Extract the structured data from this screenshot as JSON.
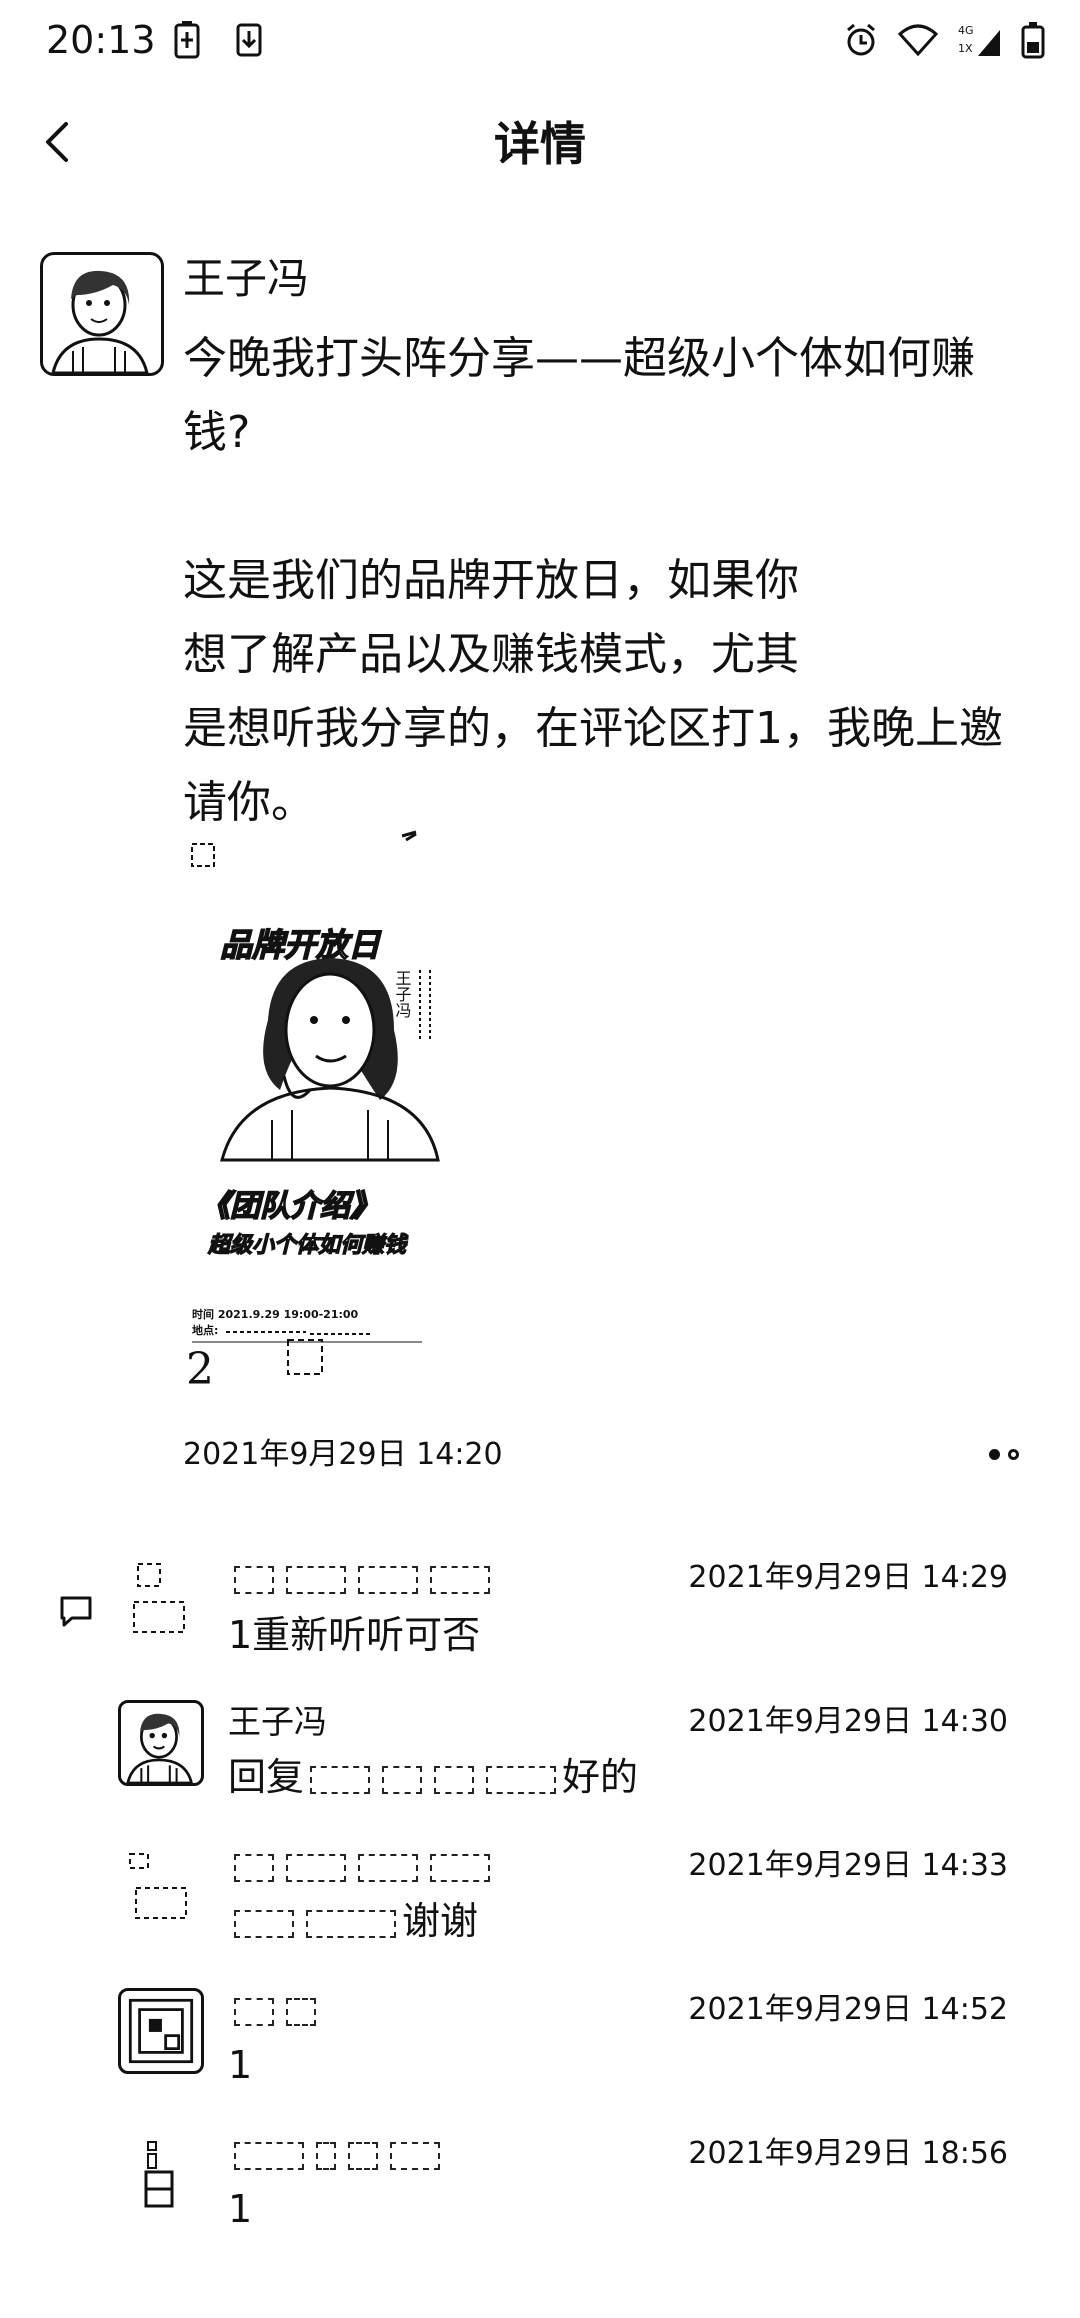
{
  "status_bar": {
    "time": "20:13",
    "left_icons": [
      "battery-saver-icon",
      "download-icon"
    ],
    "right_icons": [
      "alarm-icon",
      "wifi-icon",
      "signal-icon",
      "battery-icon"
    ],
    "network_label": "4G 1X"
  },
  "header": {
    "back_icon": "chevron-left-icon",
    "title": "详情"
  },
  "post": {
    "author": "王子冯",
    "body": "今晚我打头阵分享——超级小个体如何赚\n钱?\n\n这是我们的品牌开放日，如果你\n想了解产品以及赚钱模式，尤其\n是想听我分享的，在评论区打1，我晚上邀\n请你。",
    "image": {
      "headline": "品牌开放日",
      "name": "王子冯",
      "subtitle_1": "《团队介绍》",
      "subtitle_2": "超级小个体如何赚钱",
      "time_line": "时间 2021.9.29 19:00-21:00",
      "place_line": "地点:",
      "handwritten_mark": "2"
    },
    "timestamp": "2021年9月29日 14:20"
  },
  "comments": [
    {
      "name": "",
      "time": "2021年9月29日 14:29",
      "text": "1重新听听可否",
      "avatar": "redacted"
    },
    {
      "name": "王子冯",
      "time": "2021年9月29日 14:30",
      "text_prefix": "回复",
      "text": "好的",
      "avatar": "author"
    },
    {
      "name": "",
      "time": "2021年9月29日 14:33",
      "text": "谢谢",
      "avatar": "redacted"
    },
    {
      "name": "",
      "time": "2021年9月29日 14:52",
      "text": "1",
      "avatar": "qr"
    },
    {
      "name": "",
      "time": "2021年9月29日 18:56",
      "text": "1",
      "avatar": "redacted"
    }
  ]
}
